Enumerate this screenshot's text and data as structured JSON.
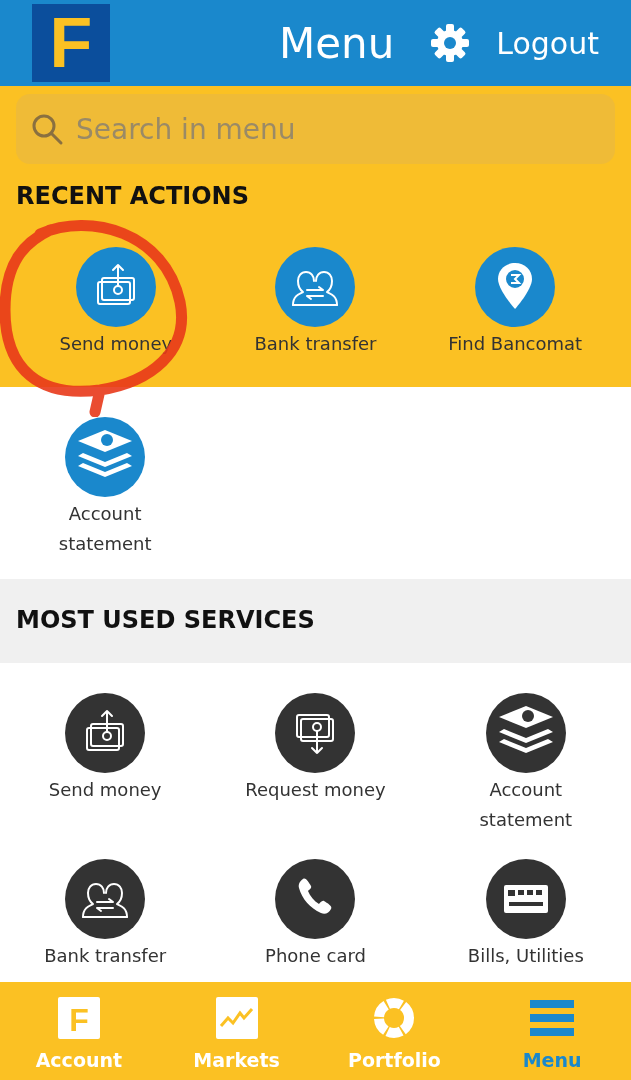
{
  "header": {
    "logo": "F",
    "title": "Menu",
    "logout": "Logout"
  },
  "search": {
    "placeholder": "Search in menu"
  },
  "recent_actions": {
    "title": "RECENT ACTIONS",
    "items": [
      {
        "label": "Send money",
        "kind": "send"
      },
      {
        "label": "Bank transfer",
        "kind": "transfer"
      },
      {
        "label": "Find Bancomat",
        "kind": "atm"
      },
      {
        "label": "Account statement",
        "kind": "statement"
      }
    ]
  },
  "most_used": {
    "title": "MOST USED SERVICES",
    "items": [
      {
        "label": "Send money",
        "kind": "send"
      },
      {
        "label": "Request money",
        "kind": "request"
      },
      {
        "label": "Account statement",
        "kind": "statement"
      },
      {
        "label": "Bank transfer",
        "kind": "transfer"
      },
      {
        "label": "Phone card",
        "kind": "phone"
      },
      {
        "label": "Bills, Utilities",
        "kind": "bills"
      }
    ]
  },
  "tabs": [
    {
      "label": "Account",
      "kind": "account",
      "icon_letter": "F",
      "selected": false
    },
    {
      "label": "Markets",
      "kind": "markets",
      "selected": false
    },
    {
      "label": "Portfolio",
      "kind": "portfolio",
      "selected": false
    },
    {
      "label": "Menu",
      "kind": "menu",
      "selected": true
    }
  ]
}
